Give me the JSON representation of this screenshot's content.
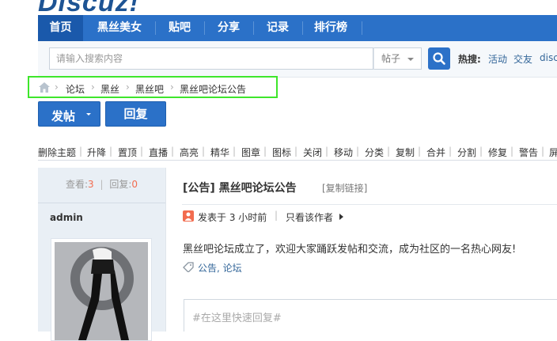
{
  "logo": {
    "text": "Discuz!"
  },
  "nav": {
    "items": [
      {
        "label": "首页",
        "active": true
      },
      {
        "label": "黑丝美女"
      },
      {
        "label": "贴吧"
      },
      {
        "label": "分享"
      },
      {
        "label": "记录"
      },
      {
        "label": "排行榜"
      }
    ]
  },
  "search": {
    "placeholder": "请输入搜索内容",
    "type_label": "帖子",
    "hot_label": "热搜:",
    "hot_links": [
      "活动",
      "交友",
      "discuz"
    ]
  },
  "breadcrumb": {
    "items": [
      "论坛",
      "黑丝",
      "黑丝吧",
      "黑丝吧论坛公告"
    ],
    "separator": "›"
  },
  "actions": {
    "post_label": "发帖",
    "reply_label": "回复"
  },
  "mod_bar": {
    "items": [
      "删除主题",
      "升降",
      "置顶",
      "直播",
      "高亮",
      "精华",
      "图章",
      "图标",
      "关闭",
      "移动",
      "分类",
      "复制",
      "合并",
      "分割",
      "修复",
      "警告",
      "屏"
    ]
  },
  "post": {
    "views_label": "查看:",
    "views": "3",
    "replies_label": "回复:",
    "replies": "0",
    "stats_sep": "|",
    "author": "admin",
    "title": "[公告] 黑丝吧论坛公告",
    "copy_link": "[复制链接]",
    "time": "发表于 3 小时前",
    "meta_sep": "|",
    "only_author": "只看该作者",
    "body": "黑丝吧论坛成立了，欢迎大家踊跃发帖和交流，成为社区的一名热心网友!",
    "tags": "公告, 论坛",
    "quick_reply_placeholder": "#在这里快速回复#"
  },
  "colors": {
    "nav_bg": "#2b71c8",
    "nav_active": "#1a59ab",
    "highlight_box": "#3ee62b",
    "stat_number": "#f26c4f"
  }
}
